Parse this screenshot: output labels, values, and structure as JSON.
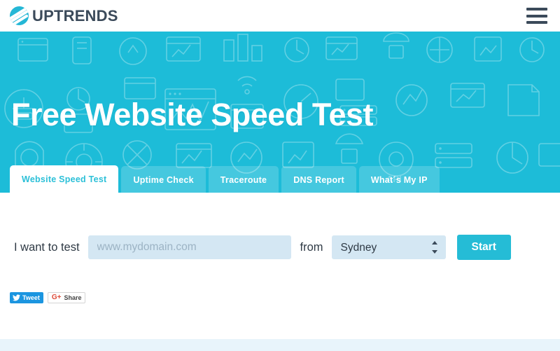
{
  "header": {
    "logo_text": "UPTRENDS",
    "logo_icon": "uptrends-circle-logo",
    "menu_icon": "hamburger-menu-icon"
  },
  "hero": {
    "title": "Free Website Speed Test",
    "background_color": "#1dbcd8"
  },
  "tabs": [
    {
      "label": "Website Speed Test",
      "active": true
    },
    {
      "label": "Uptime Check",
      "active": false
    },
    {
      "label": "Traceroute",
      "active": false
    },
    {
      "label": "DNS Report",
      "active": false
    },
    {
      "label": "What´s My IP",
      "active": false
    }
  ],
  "form": {
    "label_test": "I want to test",
    "domain_placeholder": "www.mydomain.com",
    "domain_value": "",
    "label_from": "from",
    "location_selected": "Sydney",
    "location_options": [
      "Sydney"
    ],
    "start_label": "Start"
  },
  "social": {
    "tweet_label": "Tweet",
    "tweet_icon": "twitter-bird-icon",
    "tweet_color": "#1b95e0",
    "gplus_icon_label": "G+",
    "gplus_label": "Share",
    "gplus_color": "#dd4b39"
  },
  "colors": {
    "brand_teal": "#1dbcd8",
    "accent_button": "#25bcd6",
    "logo_navy": "#3b4a5a",
    "input_blue": "#d4e7f3",
    "band_blue": "#e8f4fb"
  }
}
